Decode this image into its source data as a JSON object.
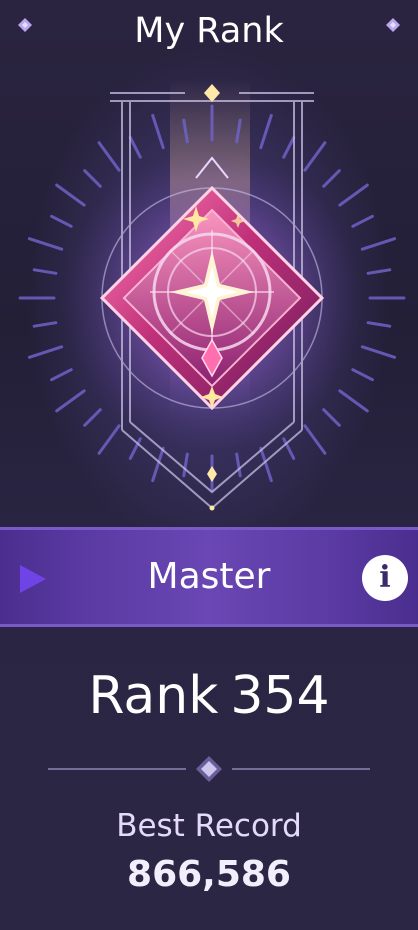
{
  "header": {
    "title": "My Rank",
    "corner_icon": "diamond-sparkle-icon"
  },
  "badge": {
    "tier_name": "Master",
    "emblem_icon": "master-rank-emblem-icon"
  },
  "banner": {
    "info_glyph": "i",
    "arrow_icon": "play-arrow-icon",
    "info_icon": "info-icon"
  },
  "rank": {
    "label": "Rank",
    "value": "354"
  },
  "best_record": {
    "label": "Best Record",
    "value": "866,586"
  },
  "colors": {
    "banner_purple": "#5a3aa3",
    "emblem_magenta": "#c0307a",
    "emblem_gold": "#ffe8a0",
    "text_white": "#ffffff"
  }
}
